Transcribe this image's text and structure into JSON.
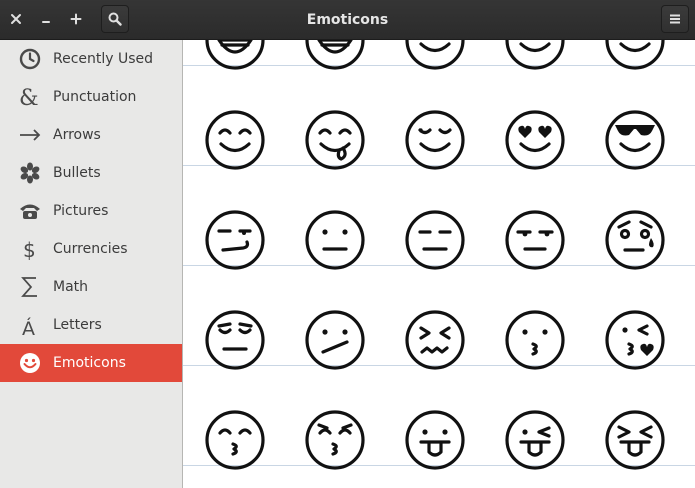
{
  "window": {
    "title": "Emoticons",
    "buttons": {
      "close_icon": "close-icon",
      "minimize_icon": "minimize-icon",
      "add_icon": "plus-icon",
      "search_icon": "search-icon",
      "menu_icon": "hamburger-menu-icon"
    }
  },
  "sidebar": {
    "items": [
      {
        "label": "Recently Used",
        "icon": "clock-icon",
        "active": false
      },
      {
        "label": "Punctuation",
        "icon": "ampersand-icon",
        "active": false
      },
      {
        "label": "Arrows",
        "icon": "arrow-right-icon",
        "active": false
      },
      {
        "label": "Bullets",
        "icon": "asterisk-bullet-icon",
        "active": false
      },
      {
        "label": "Pictures",
        "icon": "telephone-icon",
        "active": false
      },
      {
        "label": "Currencies",
        "icon": "dollar-icon",
        "active": false
      },
      {
        "label": "Math",
        "icon": "sigma-icon",
        "active": false
      },
      {
        "label": "Letters",
        "icon": "letter-a-acute-icon",
        "active": false
      },
      {
        "label": "Emoticons",
        "icon": "smiley-icon",
        "active": true
      }
    ]
  },
  "grid": {
    "rows": [
      [
        "grinning-face",
        "grinning-face-smiling-eyes",
        "smiling-face",
        "smiling-face",
        "smiling-face"
      ],
      [
        "smiling-face-smiling-eyes",
        "face-savouring-food",
        "relieved-face",
        "heart-eyes-face",
        "sunglasses-face"
      ],
      [
        "smirking-face",
        "neutral-face",
        "expressionless-face",
        "unamused-face",
        "anxious-sweat-face"
      ],
      [
        "pensive-face",
        "confused-face",
        "confounded-face",
        "kissing-face",
        "face-blowing-kiss"
      ],
      [
        "kissing-closed-eyes-face",
        "kissing-smiling-eyes-face",
        "tongue-out-face",
        "winking-tongue-face",
        "squinting-tongue-face"
      ]
    ]
  },
  "colors": {
    "titlebar": "#2f2f2f",
    "accent": "#e2493a",
    "sidebar_bg": "#e8e8e7",
    "grid_line": "#c9d6e4"
  }
}
